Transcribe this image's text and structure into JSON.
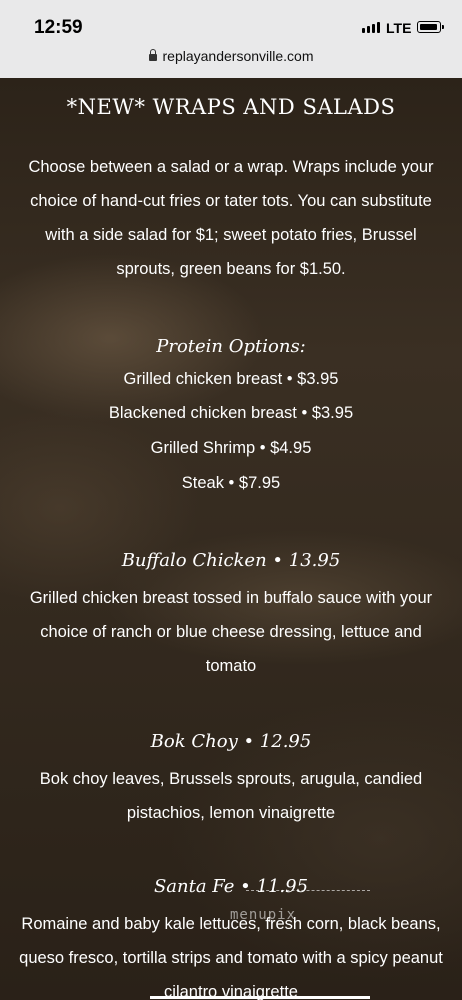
{
  "status": {
    "time": "12:59",
    "network": "LTE"
  },
  "browser": {
    "url": "replayandersonville.com"
  },
  "icons": {
    "lock": "lock-icon",
    "signal": "signal-icon",
    "battery": "battery-icon"
  },
  "menu": {
    "heading": "*NEW* WRAPS AND SALADS",
    "intro": "Choose between a salad or a wrap. Wraps include your choice of hand-cut fries or tater tots. You can substitute with a side salad for $1; sweet potato fries, Brussel sprouts, green beans for $1.50.",
    "protein_title": "Protein Options:",
    "proteins": [
      "Grilled chicken breast • $3.95",
      "Blackened chicken breast • $3.95",
      "Grilled Shrimp • $4.95",
      "Steak • $7.95"
    ],
    "items": [
      {
        "title": "Buffalo Chicken • 13.95",
        "description": "Grilled chicken breast tossed in buffalo sauce with your choice of ranch or blue cheese dressing, lettuce and tomato"
      },
      {
        "title": "Bok Choy • 12.95",
        "description": "Bok choy leaves, Brussels sprouts, arugula, candied pistachios, lemon vinaigrette"
      },
      {
        "title": "Santa Fe • 11.95",
        "description": "Romaine and baby kale lettuces, fresh corn, black beans, queso fresco, tortilla strips and tomato with a spicy peanut cilantro vinaigrette"
      }
    ]
  },
  "watermark": "menupix"
}
